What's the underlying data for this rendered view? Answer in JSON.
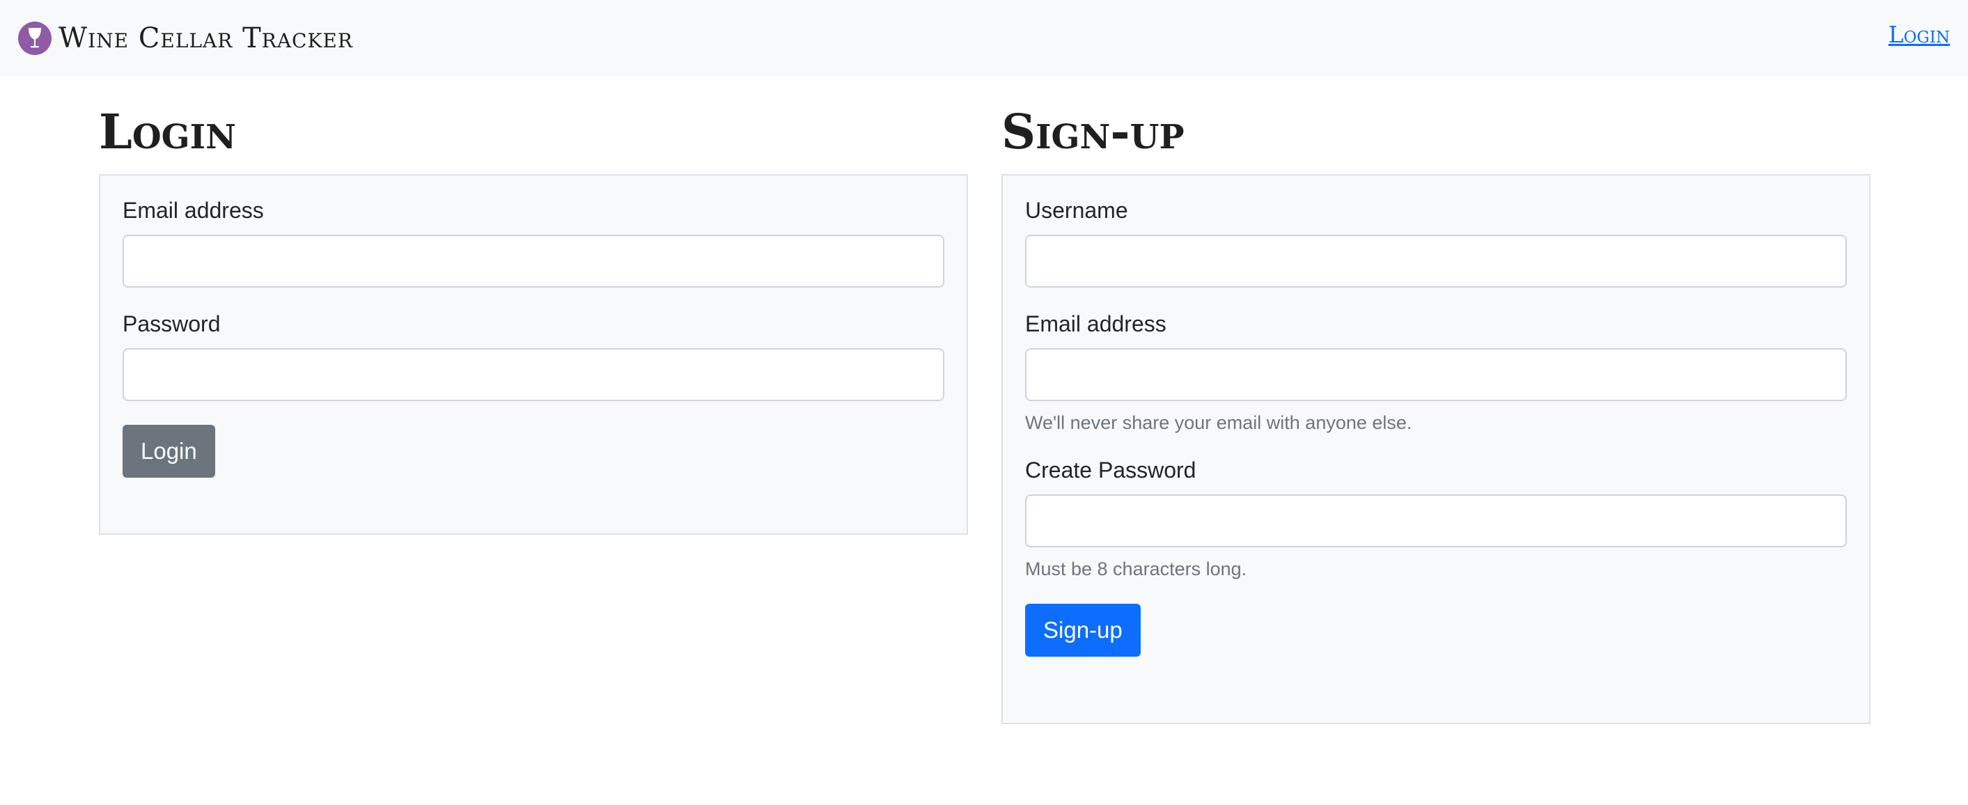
{
  "navbar": {
    "brand": "Wine Cellar Tracker",
    "login_link": "Login"
  },
  "login": {
    "title": "Login",
    "email_label": "Email address",
    "password_label": "Password",
    "button": "Login"
  },
  "signup": {
    "title": "Sign-up",
    "username_label": "Username",
    "email_label": "Email address",
    "email_help": "We'll never share your email with anyone else.",
    "password_label": "Create Password",
    "password_help": "Must be 8 characters long.",
    "button": "Sign-up"
  },
  "colors": {
    "brand_purple": "#8f5aa6",
    "primary": "#0d6efd",
    "secondary": "#6c757d",
    "navbar_bg": "#f8f9fa"
  },
  "icons": {
    "brand": "wine-glass-icon"
  }
}
